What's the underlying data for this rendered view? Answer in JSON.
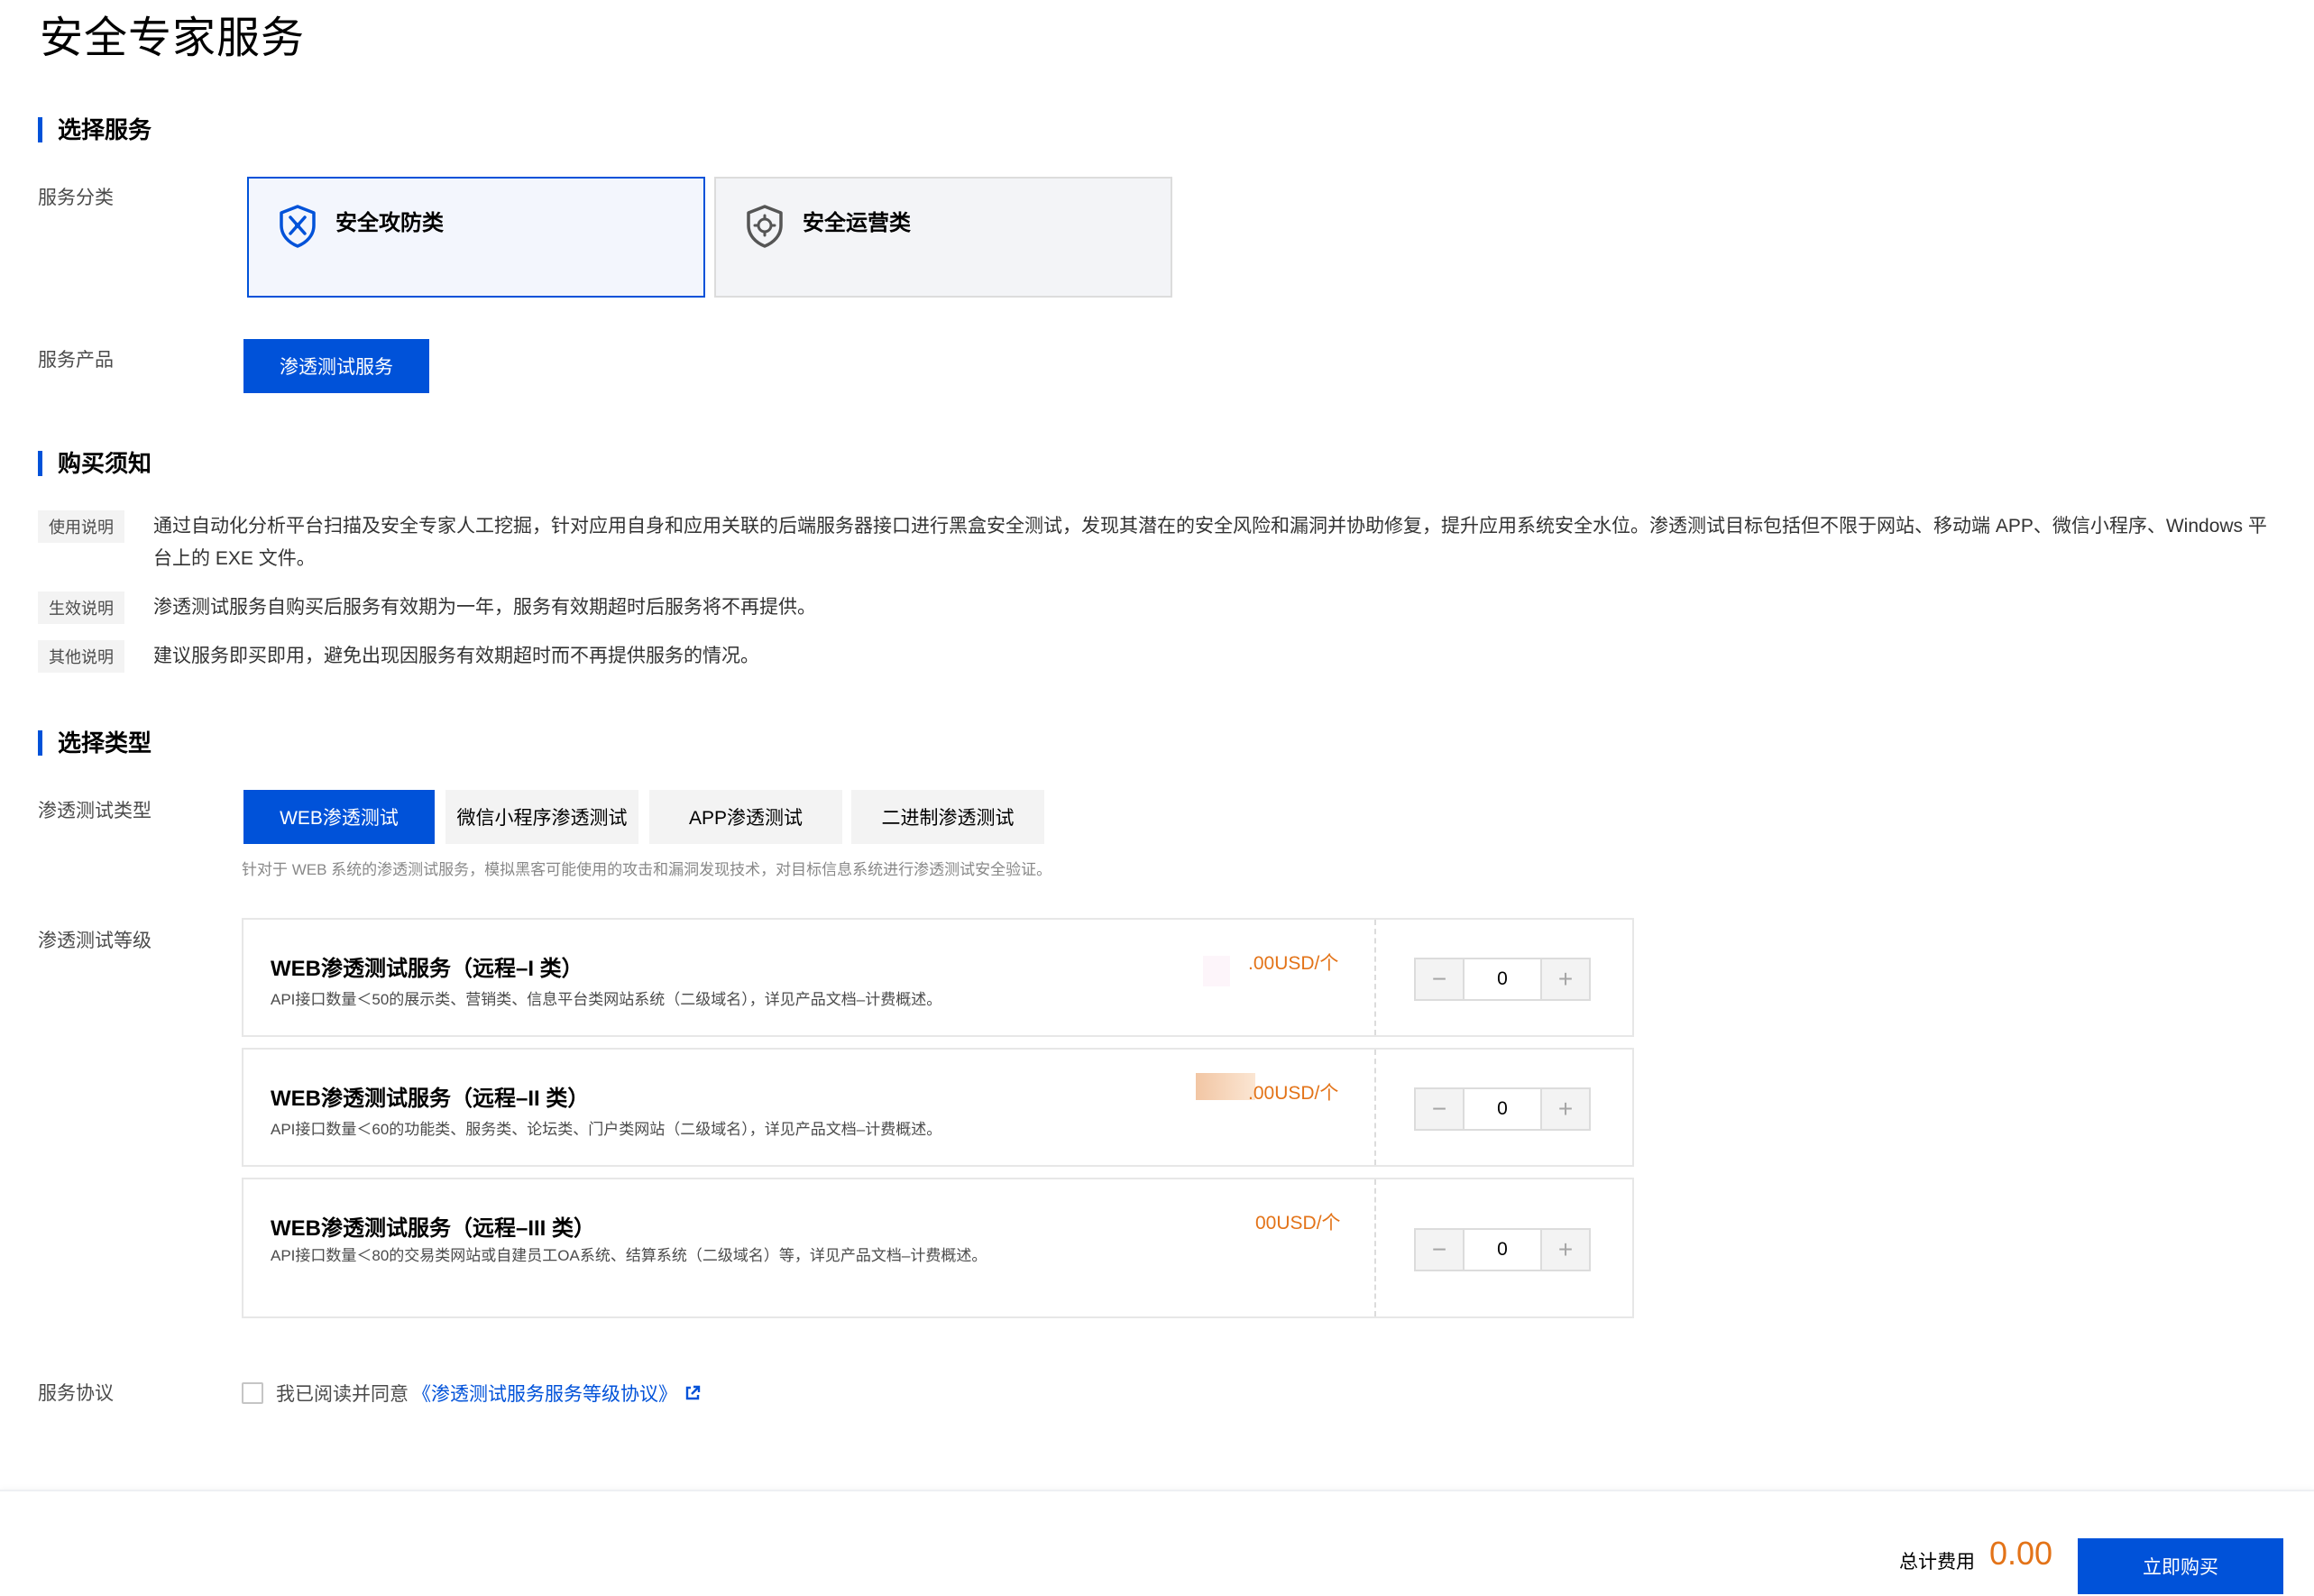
{
  "page": {
    "title": "安全专家服务"
  },
  "sections": {
    "select_service": "选择服务",
    "purchase_notice": "购买须知",
    "select_type": "选择类型"
  },
  "service_category": {
    "label": "服务分类",
    "options": [
      {
        "label": "安全攻防类",
        "icon": "shield-cross-icon",
        "selected": true
      },
      {
        "label": "安全运营类",
        "icon": "shield-gear-icon",
        "selected": false
      }
    ]
  },
  "service_product": {
    "label": "服务产品",
    "selected": "渗透测试服务"
  },
  "notices": [
    {
      "tag": "使用说明",
      "text": "通过自动化分析平台扫描及安全专家人工挖掘，针对应用自身和应用关联的后端服务器接口进行黑盒安全测试，发现其潜在的安全风险和漏洞并协助修复，提升应用系统安全水位。渗透测试目标包括但不限于网站、移动端 APP、微信小程序、Windows 平台上的 EXE 文件。"
    },
    {
      "tag": "生效说明",
      "text": "渗透测试服务自购买后服务有效期为一年，服务有效期超时后服务将不再提供。"
    },
    {
      "tag": "其他说明",
      "text": "建议服务即买即用，避免出现因服务有效期超时而不再提供服务的情况。"
    }
  ],
  "pentest_type": {
    "label": "渗透测试类型",
    "tabs": [
      "WEB渗透测试",
      "微信小程序渗透测试",
      "APP渗透测试",
      "二进制渗透测试"
    ],
    "active_index": 0,
    "description": "针对于 WEB 系统的渗透测试服务，模拟黑客可能使用的攻击和漏洞发现技术，对目标信息系统进行渗透测试安全验证。"
  },
  "pentest_level": {
    "label": "渗透测试等级",
    "rows": [
      {
        "title": "WEB渗透测试服务（远程–I 类）",
        "desc": "API接口数量＜50的展示类、营销类、信息平台类网站系统（二级域名），详见产品文档–计费概述。",
        "price": ".00USD/个",
        "qty": "0"
      },
      {
        "title": "WEB渗透测试服务（远程–II 类）",
        "desc": "API接口数量＜60的功能类、服务类、论坛类、门户类网站（二级域名），详见产品文档–计费概述。",
        "price": ".00USD/个",
        "qty": "0"
      },
      {
        "title": "WEB渗透测试服务（远程–III 类）",
        "desc": "API接口数量＜80的交易类网站或自建员工OA系统、结算系统（二级域名）等，详见产品文档–计费概述。",
        "price": "00USD/个",
        "qty": "0"
      }
    ],
    "minus": "−",
    "plus": "+"
  },
  "agreement": {
    "label": "服务协议",
    "text": "我已阅读并同意",
    "link": "《渗透测试服务服务等级协议》",
    "checked": false
  },
  "footer": {
    "total_label": "总计费用",
    "total_value": "0.00",
    "buy_label": "立即购买"
  },
  "colors": {
    "primary": "#0052d9",
    "price": "#e37318",
    "card_bg": "#f3f4f7"
  }
}
